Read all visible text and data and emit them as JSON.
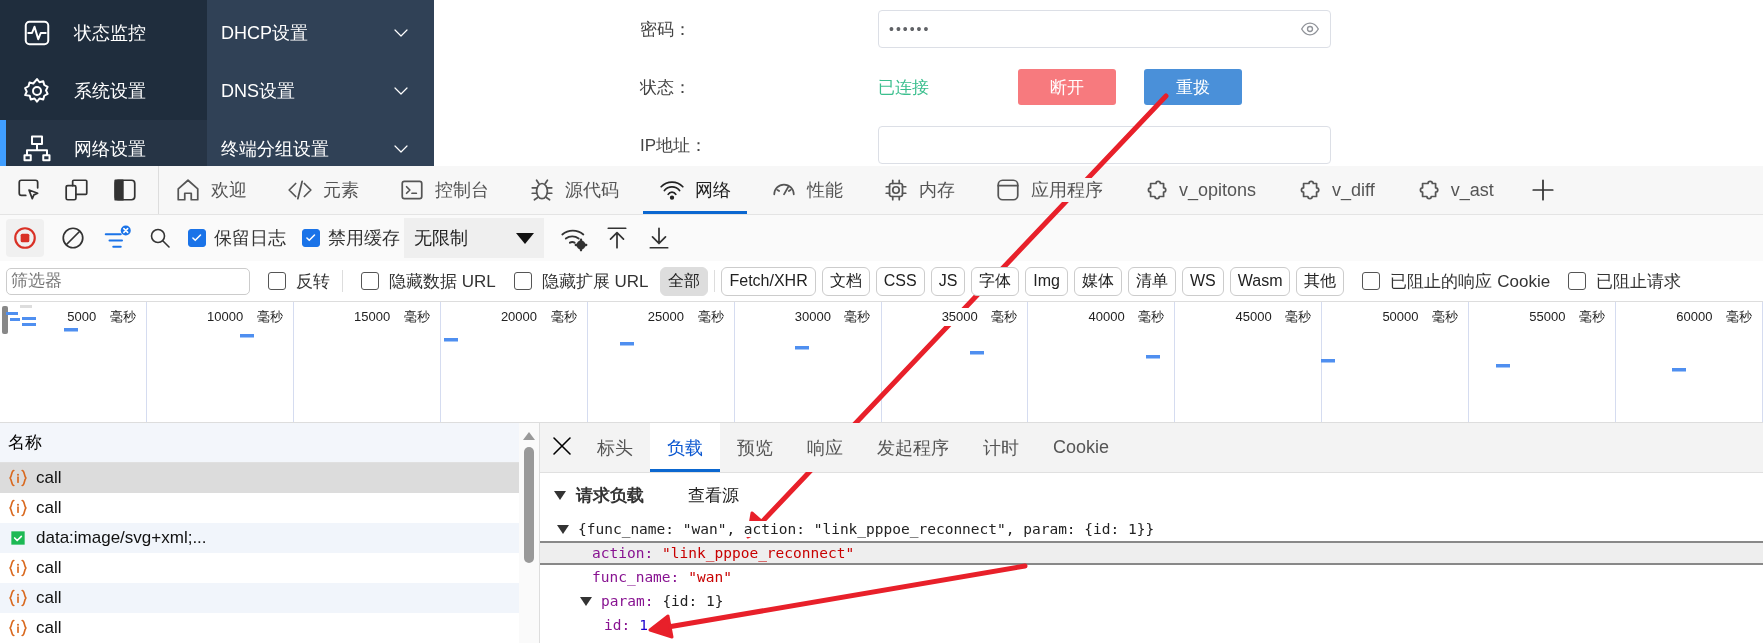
{
  "app": {
    "sidebar": [
      {
        "label": "状态监控",
        "selected": false
      },
      {
        "label": "系统设置",
        "selected": false
      },
      {
        "label": "网络设置",
        "selected": true
      }
    ],
    "submenu": [
      {
        "label": "DHCP设置"
      },
      {
        "label": "DNS设置"
      },
      {
        "label": "终端分组设置"
      }
    ],
    "form": [
      {
        "kind": "password",
        "label": "密码：",
        "value": "••••••"
      },
      {
        "kind": "status",
        "label": "状态：",
        "value": "已连接",
        "buttons": [
          {
            "label": "断开",
            "kind": "danger"
          },
          {
            "label": "重拨",
            "kind": "primary"
          }
        ]
      },
      {
        "kind": "text",
        "label": "IP地址："
      }
    ]
  },
  "devtools": {
    "tabs": [
      {
        "label": "欢迎",
        "selected": false
      },
      {
        "label": "元素",
        "selected": false
      },
      {
        "label": "控制台",
        "selected": false
      },
      {
        "label": "源代码",
        "selected": false
      },
      {
        "label": "网络",
        "selected": true
      },
      {
        "label": "性能",
        "selected": false
      },
      {
        "label": "内存",
        "selected": false
      },
      {
        "label": "应用程序",
        "selected": false
      },
      {
        "label": "v_opitons",
        "selected": false
      },
      {
        "label": "v_diff",
        "selected": false
      },
      {
        "label": "v_ast",
        "selected": false
      }
    ],
    "toolbar": {
      "checkboxes": [
        {
          "label": "保留日志",
          "checked": true
        },
        {
          "label": "禁用缓存",
          "checked": true
        }
      ],
      "throttling": "无限制"
    },
    "filter": {
      "placeholder": "筛选器",
      "options": [
        {
          "label": "反转",
          "checked": false
        },
        {
          "label": "隐藏数据 URL",
          "checked": false
        },
        {
          "label": "隐藏扩展 URL",
          "checked": false
        }
      ],
      "types": [
        {
          "label": "全部",
          "selected": true
        },
        {
          "label": "Fetch/XHR",
          "selected": false
        },
        {
          "label": "文档",
          "selected": false
        },
        {
          "label": "CSS",
          "selected": false
        },
        {
          "label": "JS",
          "selected": false
        },
        {
          "label": "字体",
          "selected": false
        },
        {
          "label": "Img",
          "selected": false
        },
        {
          "label": "媒体",
          "selected": false
        },
        {
          "label": "清单",
          "selected": false
        },
        {
          "label": "WS",
          "selected": false
        },
        {
          "label": "Wasm",
          "selected": false
        },
        {
          "label": "其他",
          "selected": false
        }
      ],
      "blocked": [
        {
          "label": "已阻止的响应 Cookie",
          "checked": false
        },
        {
          "label": "已阻止请求",
          "checked": false
        }
      ]
    },
    "timeline": {
      "ticks": [
        "5000 毫秒",
        "10000 毫秒",
        "15000 毫秒",
        "20000 毫秒",
        "25000 毫秒",
        "30000 毫秒",
        "35000 毫秒",
        "40000 毫秒",
        "45000 毫秒",
        "50000 毫秒",
        "55000 毫秒",
        "60000 毫秒"
      ]
    },
    "requests": {
      "column": "名称",
      "rows": [
        {
          "kind": "xhr",
          "name": "call",
          "selected": true
        },
        {
          "kind": "xhr",
          "name": "call",
          "selected": false
        },
        {
          "kind": "image",
          "name": "data:image/svg+xml;...",
          "selected": false
        },
        {
          "kind": "xhr",
          "name": "call",
          "selected": false
        },
        {
          "kind": "xhr",
          "name": "call",
          "selected": false
        },
        {
          "kind": "xhr",
          "name": "call",
          "selected": false
        }
      ]
    },
    "details": {
      "tabs": [
        {
          "label": "标头",
          "selected": false
        },
        {
          "label": "负载",
          "selected": true
        },
        {
          "label": "预览",
          "selected": false
        },
        {
          "label": "响应",
          "selected": false
        },
        {
          "label": "发起程序",
          "selected": false
        },
        {
          "label": "计时",
          "selected": false
        },
        {
          "label": "Cookie",
          "selected": false
        }
      ],
      "section": "请求负载",
      "view_source": "查看源",
      "summary": "{func_name: \"wan\", action: \"link_pppoe_reconnect\", param: {id: 1}}",
      "properties": [
        {
          "key": "action:",
          "value": "\"link_pppoe_reconnect\"",
          "kind": "string",
          "selected": true
        },
        {
          "key": "func_name:",
          "value": "\"wan\"",
          "kind": "string",
          "selected": false
        },
        {
          "key": "param:",
          "value": "{id: 1}",
          "kind": "object",
          "selected": false,
          "children": [
            {
              "key": "id:",
              "value": "1",
              "kind": "number",
              "selected": false
            }
          ]
        }
      ]
    }
  }
}
